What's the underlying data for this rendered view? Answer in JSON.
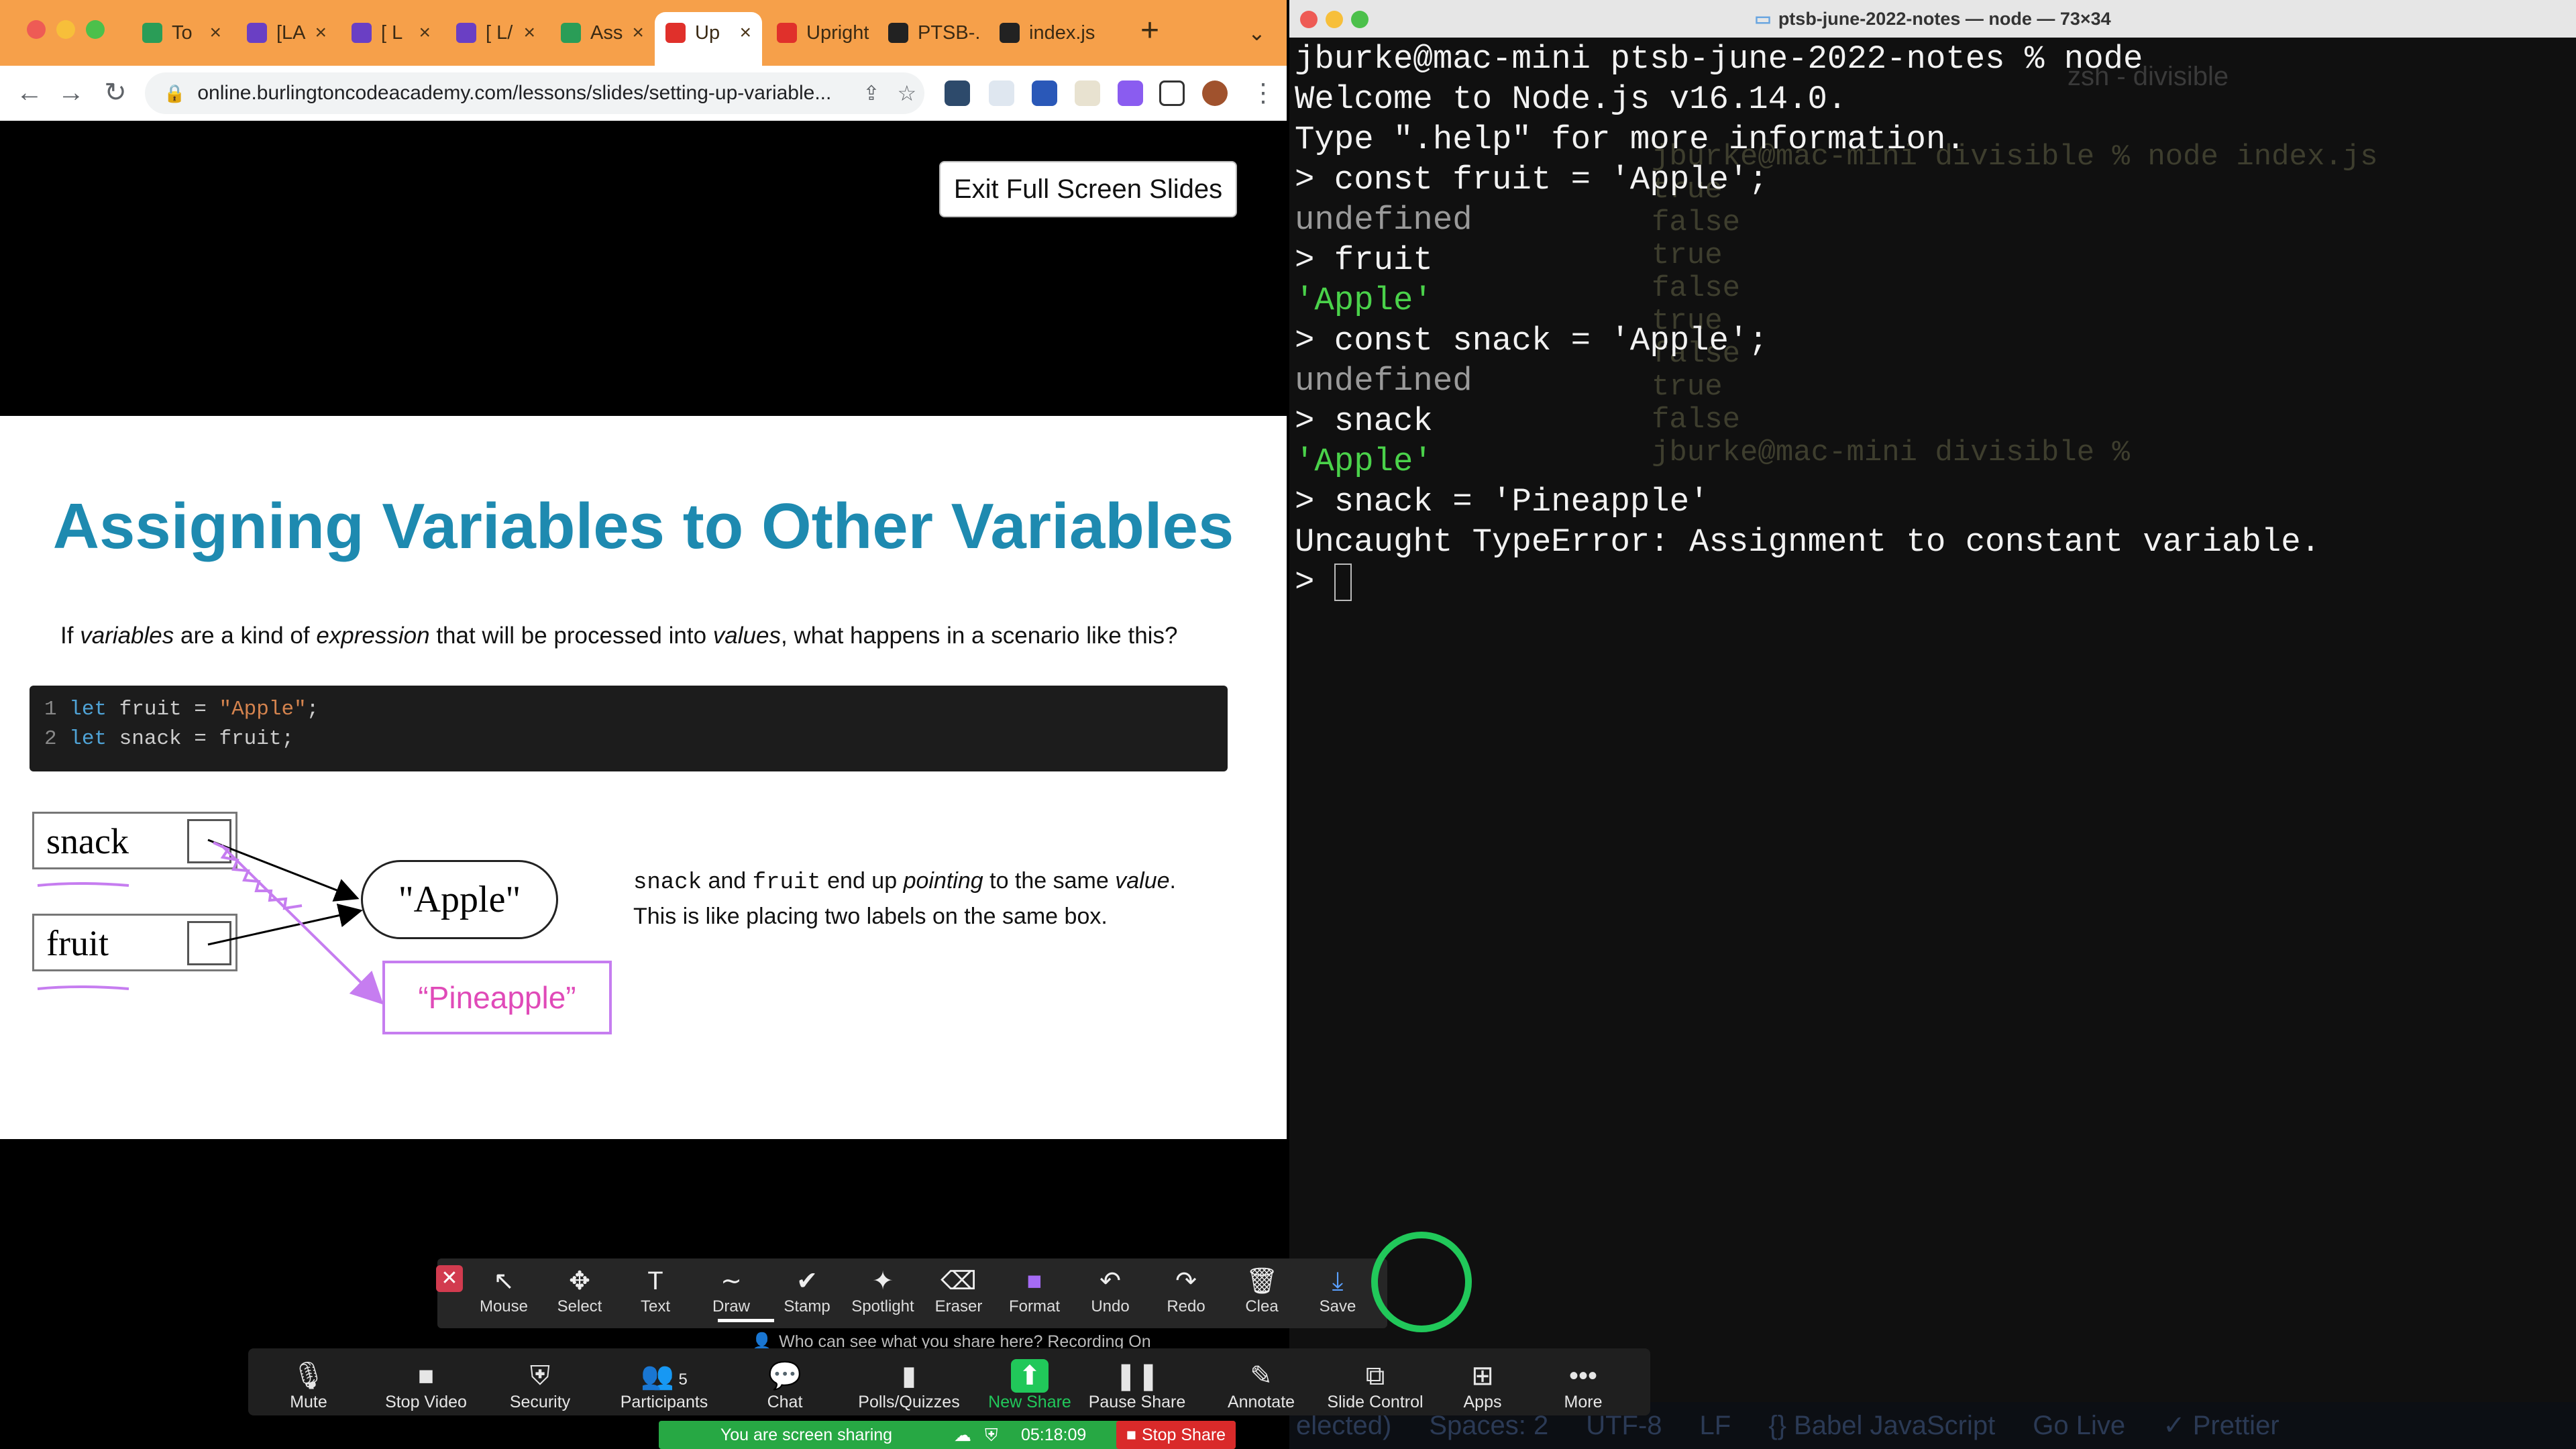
{
  "browser": {
    "tabs": [
      {
        "label": "To",
        "favicon_color": "#2a9d57"
      },
      {
        "label": "[LA",
        "favicon_color": "#6a3fc4"
      },
      {
        "label": "[ L",
        "favicon_color": "#6a3fc4"
      },
      {
        "label": "[ L/",
        "favicon_color": "#6a3fc4"
      },
      {
        "label": "Ass",
        "favicon_color": "#2a9d57"
      },
      {
        "label": "Up",
        "favicon_color": "#e0302b",
        "active": true
      },
      {
        "label": "Upright",
        "favicon_color": "#e0302b"
      },
      {
        "label": "PTSB-.",
        "favicon_color": "#222222"
      },
      {
        "label": "index.js",
        "favicon_color": "#222222"
      }
    ],
    "new_tab_icon": "plus-icon",
    "url": "online.burlingtoncodeacademy.com/lessons/slides/setting-up-variable...",
    "accent": "#f6a04a"
  },
  "slide": {
    "exit_button": "Exit Full Screen Slides",
    "title": "Assigning Variables to Other Variables",
    "intro_parts": [
      "If ",
      "variables",
      " are a kind of ",
      "expression",
      " that will be processed into ",
      "values",
      ", what happens in a scenario like this?"
    ],
    "code": [
      {
        "n": "1",
        "kw": "let",
        "rest": " fruit = ",
        "str": "\"Apple\"",
        "end": ";"
      },
      {
        "n": "2",
        "kw": "let",
        "rest": " snack = fruit",
        "str": "",
        "end": ";"
      }
    ],
    "var_snack": "snack",
    "var_fruit": "fruit",
    "value_apple": "\"Apple\"",
    "value_pineapple": "“Pineapple”",
    "explain_snack": "snack",
    "explain_and": " and ",
    "explain_fruit": "fruit",
    "explain_end": " end up ",
    "explain_pointing": "pointing",
    "explain_to": " to the same ",
    "explain_value": "value",
    "explain_period": ".",
    "explain_line2": "This is like placing two labels on the same box.",
    "title_color": "#1e8ab0",
    "annotation_color": "#c67df0"
  },
  "annotate_toolbar": {
    "tools": [
      {
        "label": "Mouse",
        "icon": "↖"
      },
      {
        "label": "Select",
        "icon": "✥"
      },
      {
        "label": "Text",
        "icon": "T"
      },
      {
        "label": "Draw",
        "icon": "∼"
      },
      {
        "label": "Stamp",
        "icon": "✔"
      },
      {
        "label": "Spotlight",
        "icon": "✦"
      },
      {
        "label": "Eraser",
        "icon": "⌫"
      },
      {
        "label": "Format",
        "icon": "■"
      },
      {
        "label": "Undo",
        "icon": "↶"
      },
      {
        "label": "Redo",
        "icon": "↷"
      },
      {
        "label": "Clea",
        "icon": "🗑"
      },
      {
        "label": "Save",
        "icon": "⤓"
      }
    ],
    "recording_note": "Who can see what you share here? Recording On"
  },
  "zoom_controls": {
    "buttons": [
      {
        "label": "Mute",
        "icon": "🎙"
      },
      {
        "label": "Stop Video",
        "icon": "■"
      },
      {
        "label": "Security",
        "icon": "⛨"
      },
      {
        "label": "Participants",
        "icon": "👥",
        "count": "5"
      },
      {
        "label": "Chat",
        "icon": "💬"
      },
      {
        "label": "Polls/Quizzes",
        "icon": "▮"
      },
      {
        "label": "New Share",
        "icon": "⬆"
      },
      {
        "label": "Pause Share",
        "icon": "❚❚"
      },
      {
        "label": "Annotate",
        "icon": "✎"
      },
      {
        "label": "Slide Control",
        "icon": "⧉"
      },
      {
        "label": "Apps",
        "icon": "⊞"
      },
      {
        "label": "More",
        "icon": "•••"
      }
    ],
    "sharing_text": "You are screen sharing",
    "share_time": "05:18:09",
    "stop_share": "Stop Share",
    "new_share_color": "#21c85a"
  },
  "terminal": {
    "title": "ptsb-june-2022-notes — node — 73×34",
    "lines": [
      {
        "text": "jburke@mac-mini ptsb-june-2022-notes % node",
        "style": "default"
      },
      {
        "text": "Welcome to Node.js v16.14.0.",
        "style": "default"
      },
      {
        "text": "Type \".help\" for more information.",
        "style": "default"
      },
      {
        "text": "> const fruit = 'Apple';",
        "style": "default"
      },
      {
        "text": "undefined",
        "style": "dim"
      },
      {
        "text": "> fruit",
        "style": "default"
      },
      {
        "text": "'Apple'",
        "style": "green"
      },
      {
        "text": "> const snack = 'Apple';",
        "style": "default"
      },
      {
        "text": "undefined",
        "style": "dim"
      },
      {
        "text": "> snack",
        "style": "default"
      },
      {
        "text": "'Apple'",
        "style": "green"
      },
      {
        "text": "> snack = 'Pineapple'",
        "style": "default"
      },
      {
        "text": "Uncaught TypeError: Assignment to constant variable.",
        "style": "default"
      },
      {
        "text": "> ",
        "style": "default"
      }
    ],
    "ghost_tab": "zsh - divisible",
    "ghost_lines": [
      "jburke@mac-mini divisible % node index.js",
      "true",
      "false",
      "true",
      "false",
      "true",
      "false",
      "true",
      "false",
      "jburke@mac-mini divisible % "
    ],
    "ghost_status": [
      "elected)",
      "Spaces: 2",
      "UTF-8",
      "LF",
      "{} Babel JavaScript",
      "Go Live",
      "✓ Prettier"
    ]
  }
}
